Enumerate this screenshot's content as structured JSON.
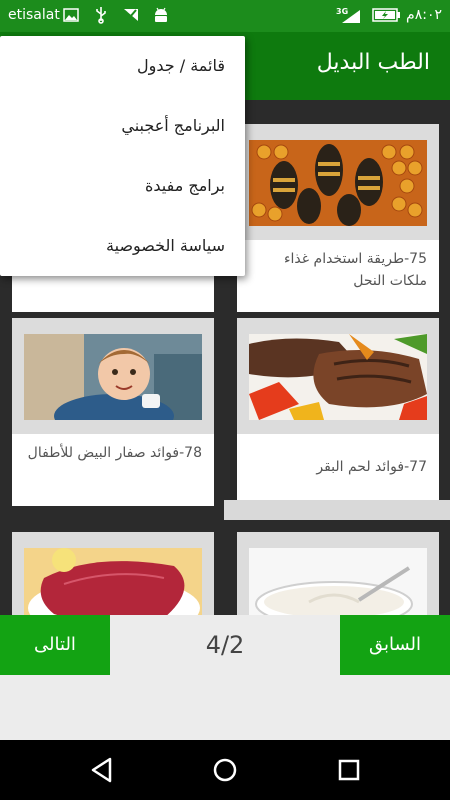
{
  "status_bar": {
    "carrier": "etisalat",
    "network": "3G",
    "time": "٨:٠٢م"
  },
  "app_bar": {
    "title": "الطب البديل"
  },
  "menu": {
    "items": [
      {
        "label": "قائمة / جدول"
      },
      {
        "label": "البرنامج أعجبني"
      },
      {
        "label": "برامج مفيدة"
      },
      {
        "label": "سياسة الخصوصية"
      }
    ]
  },
  "cards": [
    {
      "caption": "75-طريقة استخدام غذاء ملكات النحل",
      "image": "honey-bees-image"
    },
    {
      "caption": "",
      "image": "hidden-card-image"
    },
    {
      "caption": "77-فوائد لحم البقر",
      "image": "beef-steak-image"
    },
    {
      "caption": "78-فوائد صفار البيض للأطفال",
      "image": "child-eating-image"
    },
    {
      "caption": "",
      "image": "yogurt-bowl-image"
    },
    {
      "caption": "",
      "image": "raw-meat-image"
    }
  ],
  "pager": {
    "prev_label": "السابق",
    "next_label": "التالى",
    "page_indicator": "4/2"
  },
  "colors": {
    "status_bar": "#1c8c1c",
    "app_bar": "#0e7a0e",
    "button": "#13a313",
    "content_bg": "#2b2b2b"
  }
}
